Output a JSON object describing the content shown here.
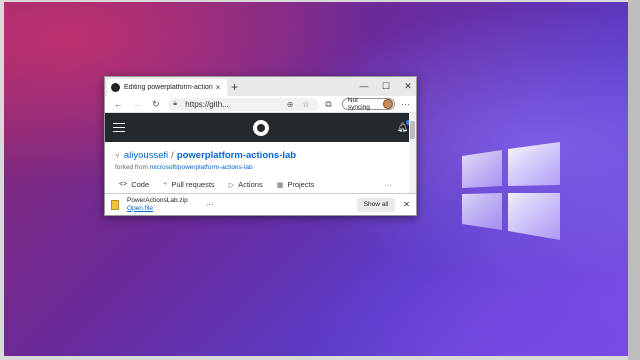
{
  "browser": {
    "tab_title": "Editing powerplatform-actions-la",
    "tab_close": "×",
    "new_tab": "+",
    "window_controls": {
      "minimize": "—",
      "maximize": "☐",
      "close": "✕"
    },
    "toolbar": {
      "back": "←",
      "forward": "→",
      "refresh": "↻",
      "url": "https://gith...",
      "zoom_icon": "⊕",
      "favorite_icon": "☆",
      "collections_icon": "⧉",
      "sync_label": "Not syncing",
      "more": "···"
    }
  },
  "github": {
    "repo_owner": "aliyoussefi",
    "repo_separator": "/",
    "repo_name": "powerplatform-actions-lab",
    "forked_from_prefix": "forked from",
    "forked_from_repo": "microsoft/powerplatform-actions-lab",
    "tabs": [
      {
        "icon": "<>",
        "label": "Code"
      },
      {
        "icon": "⑂",
        "label": "Pull requests"
      },
      {
        "icon": "▷",
        "label": "Actions"
      },
      {
        "icon": "▦",
        "label": "Projects"
      }
    ],
    "tabs_more": "···"
  },
  "download": {
    "filename": "PowerActionsLab.zip",
    "open_label": "Open file",
    "more": "···",
    "show_all": "Show all",
    "close": "✕"
  },
  "colors": {
    "github_header": "#24292e",
    "link_blue": "#0366d6"
  },
  "icons": {
    "tab_favicon": "github-favicon-icon",
    "hamburger": "hamburger-menu-icon",
    "github_logo": "github-logo-icon",
    "bell": "notification-bell-icon",
    "fork": "fork-icon",
    "zip": "zip-file-icon",
    "windows_logo": "windows-logo-icon"
  }
}
